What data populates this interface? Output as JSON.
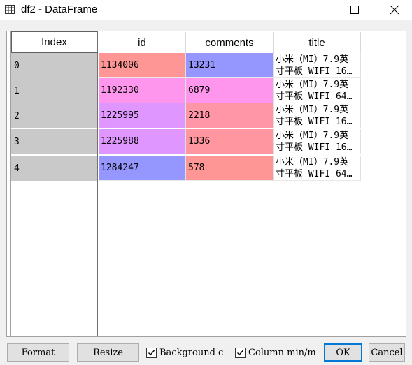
{
  "window": {
    "title": "df2 - DataFrame",
    "icon": "table-icon"
  },
  "table": {
    "index_header": "Index",
    "columns": [
      "id",
      "comments",
      "title"
    ],
    "rows": [
      {
        "index": "0",
        "id": "1134006",
        "comments": "13231",
        "title_line1": "小米（MI）7.9英",
        "title_line2": "寸平板 WIFI 16…"
      },
      {
        "index": "1",
        "id": "1192330",
        "comments": "6879",
        "title_line1": "小米（MI）7.9英",
        "title_line2": "寸平板 WIFI 64…"
      },
      {
        "index": "2",
        "id": "1225995",
        "comments": "2218",
        "title_line1": "小米（MI）7.9英",
        "title_line2": "寸平板 WIFI 16…"
      },
      {
        "index": "3",
        "id": "1225988",
        "comments": "1336",
        "title_line1": "小米（MI）7.9英",
        "title_line2": "寸平板 WIFI 16…"
      },
      {
        "index": "4",
        "id": "1284247",
        "comments": "578",
        "title_line1": "小米（MI）7.9英",
        "title_line2": "寸平板 WIFI 64…"
      }
    ],
    "cell_colors": {
      "id": [
        "#ff9696",
        "#ff96ee",
        "#df96ff",
        "#df96ff",
        "#9696ff"
      ],
      "comments": [
        "#9696ff",
        "#ff96ee",
        "#ff96a8",
        "#ff96a0",
        "#ff9696"
      ]
    },
    "index_bg": "#c9c9c9"
  },
  "controls": {
    "format_label": "Format",
    "resize_label": "Resize",
    "background_label": "Background c",
    "background_checked": true,
    "column_minmax_label": "Column min/m",
    "column_minmax_checked": true,
    "ok_label": "OK",
    "cancel_label": "Cancel",
    "accent": "#0078d7"
  }
}
